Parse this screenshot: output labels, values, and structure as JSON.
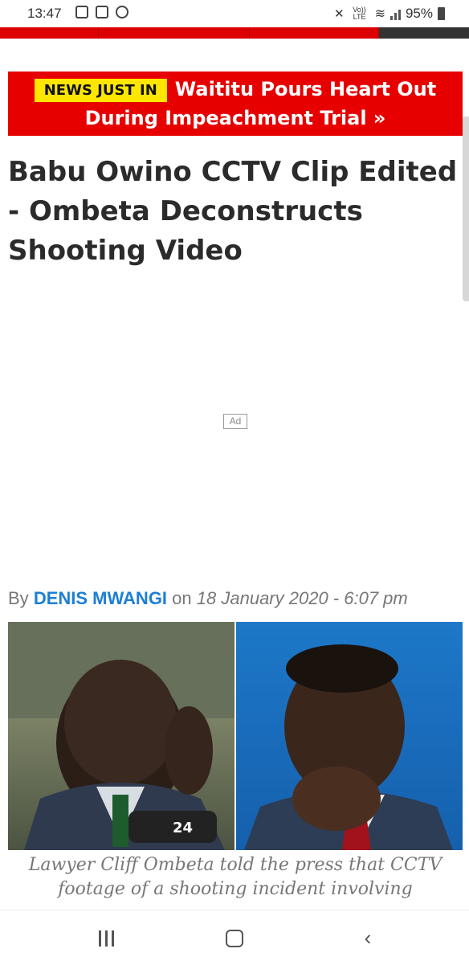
{
  "status_bar": {
    "time": "13:47",
    "network": "Vo)) LTE",
    "battery": "95%",
    "icons": [
      "image-icon",
      "instagram-icon",
      "whatsapp-icon",
      "mute-icon",
      "wifi-icon",
      "signal-icon",
      "battery-icon"
    ]
  },
  "nav_strip": {
    "colors": [
      "#dd0000",
      "#333333"
    ]
  },
  "breaking": {
    "badge": "NEWS JUST IN",
    "headline_line1": "Waititu Pours Heart Out",
    "headline_line2": "During Impeachment Trial »",
    "bg_color": "#e60000",
    "badge_color": "#ffe600"
  },
  "article": {
    "title": "Babu Owino CCTV Clip Edited - Ombeta Deconstructs Shooting Video",
    "ad_label": "Ad",
    "byline_prefix": "By",
    "author": "DENIS MWANGI",
    "byline_on": "on",
    "date": "18 January 2020 - 6:07 pm",
    "caption": "Lawyer Cliff Ombeta told the press that CCTV footage of a shooting incident involving"
  },
  "nav_bar": {
    "buttons": [
      "recents-icon",
      "home-icon",
      "back-icon"
    ],
    "back_glyph": "‹"
  }
}
